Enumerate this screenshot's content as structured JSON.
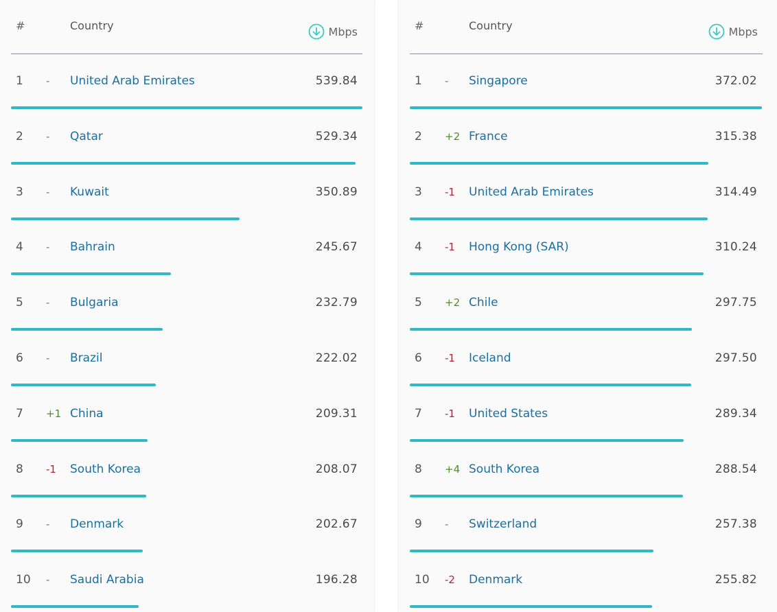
{
  "headers": {
    "rank": "#",
    "country": "Country",
    "unit": "Mbps"
  },
  "accent_color": "#2fb8c6",
  "left": {
    "rows": [
      {
        "rank": "1",
        "change": "-",
        "country": "United Arab Emirates",
        "speed": "539.84",
        "dir": "same"
      },
      {
        "rank": "2",
        "change": "-",
        "country": "Qatar",
        "speed": "529.34",
        "dir": "same"
      },
      {
        "rank": "3",
        "change": "-",
        "country": "Kuwait",
        "speed": "350.89",
        "dir": "same"
      },
      {
        "rank": "4",
        "change": "-",
        "country": "Bahrain",
        "speed": "245.67",
        "dir": "same"
      },
      {
        "rank": "5",
        "change": "-",
        "country": "Bulgaria",
        "speed": "232.79",
        "dir": "same"
      },
      {
        "rank": "6",
        "change": "-",
        "country": "Brazil",
        "speed": "222.02",
        "dir": "same"
      },
      {
        "rank": "7",
        "change": "+1",
        "country": "China",
        "speed": "209.31",
        "dir": "up"
      },
      {
        "rank": "8",
        "change": "-1",
        "country": "South Korea",
        "speed": "208.07",
        "dir": "down"
      },
      {
        "rank": "9",
        "change": "-",
        "country": "Denmark",
        "speed": "202.67",
        "dir": "same"
      },
      {
        "rank": "10",
        "change": "-",
        "country": "Saudi Arabia",
        "speed": "196.28",
        "dir": "same"
      }
    ]
  },
  "right": {
    "rows": [
      {
        "rank": "1",
        "change": "-",
        "country": "Singapore",
        "speed": "372.02",
        "dir": "same"
      },
      {
        "rank": "2",
        "change": "+2",
        "country": "France",
        "speed": "315.38",
        "dir": "up"
      },
      {
        "rank": "3",
        "change": "-1",
        "country": "United Arab Emirates",
        "speed": "314.49",
        "dir": "down"
      },
      {
        "rank": "4",
        "change": "-1",
        "country": "Hong Kong (SAR)",
        "speed": "310.24",
        "dir": "down"
      },
      {
        "rank": "5",
        "change": "+2",
        "country": "Chile",
        "speed": "297.75",
        "dir": "up"
      },
      {
        "rank": "6",
        "change": "-1",
        "country": "Iceland",
        "speed": "297.50",
        "dir": "down"
      },
      {
        "rank": "7",
        "change": "-1",
        "country": "United States",
        "speed": "289.34",
        "dir": "down"
      },
      {
        "rank": "8",
        "change": "+4",
        "country": "South Korea",
        "speed": "288.54",
        "dir": "up"
      },
      {
        "rank": "9",
        "change": "-",
        "country": "Switzerland",
        "speed": "257.38",
        "dir": "same"
      },
      {
        "rank": "10",
        "change": "-2",
        "country": "Denmark",
        "speed": "255.82",
        "dir": "down"
      }
    ]
  }
}
